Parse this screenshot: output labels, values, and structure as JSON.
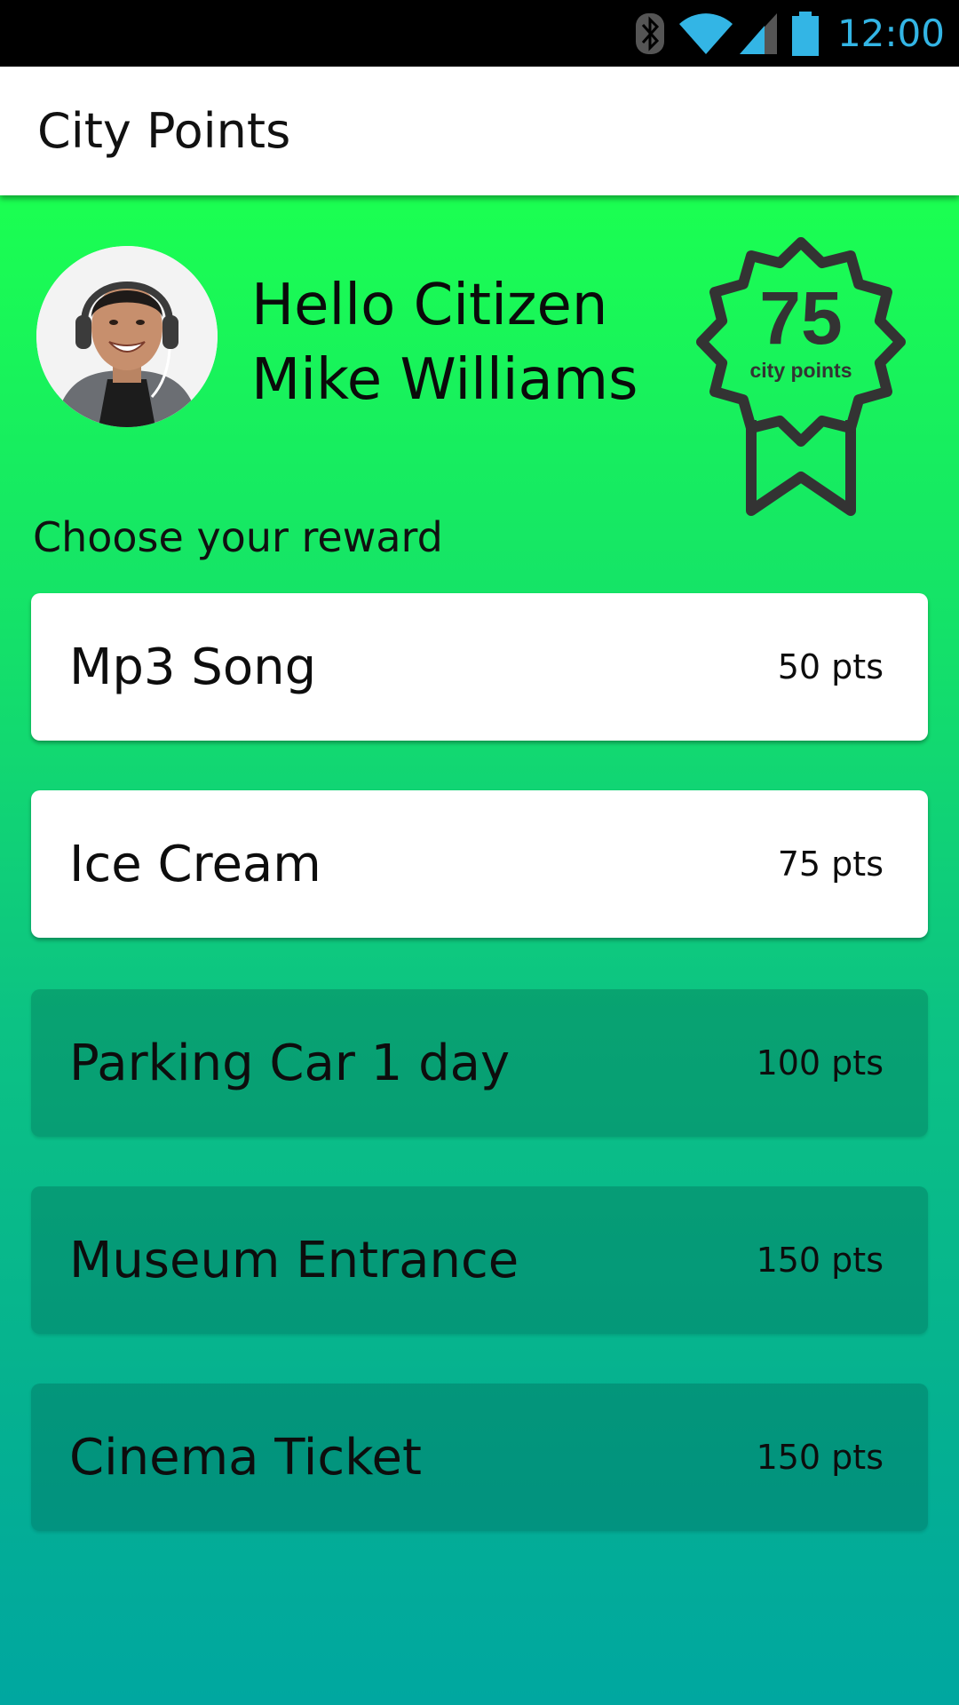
{
  "status_bar": {
    "time": "12:00",
    "icons": [
      "bluetooth-icon",
      "wifi-icon",
      "cell-signal-icon",
      "battery-icon"
    ],
    "accent_color": "#33b5e5"
  },
  "app_bar": {
    "title": "City Points"
  },
  "profile": {
    "greeting_line1": "Hello Citizen",
    "greeting_line2": "Mike Williams",
    "points": "75",
    "points_label": "city points"
  },
  "rewards": {
    "heading": "Choose your reward",
    "items": [
      {
        "name": "Mp3 Song",
        "points": "50 pts",
        "available": true
      },
      {
        "name": "Ice Cream",
        "points": "75 pts",
        "available": true
      },
      {
        "name": "Parking Car 1 day",
        "points": "100 pts",
        "available": false
      },
      {
        "name": "Museum Entrance",
        "points": "150 pts",
        "available": false
      },
      {
        "name": "Cinema Ticket",
        "points": "150 pts",
        "available": false
      }
    ]
  },
  "colors": {
    "gradient_top": "#1bff51",
    "gradient_bottom": "#00a7a0",
    "badge_stroke": "#333333"
  }
}
